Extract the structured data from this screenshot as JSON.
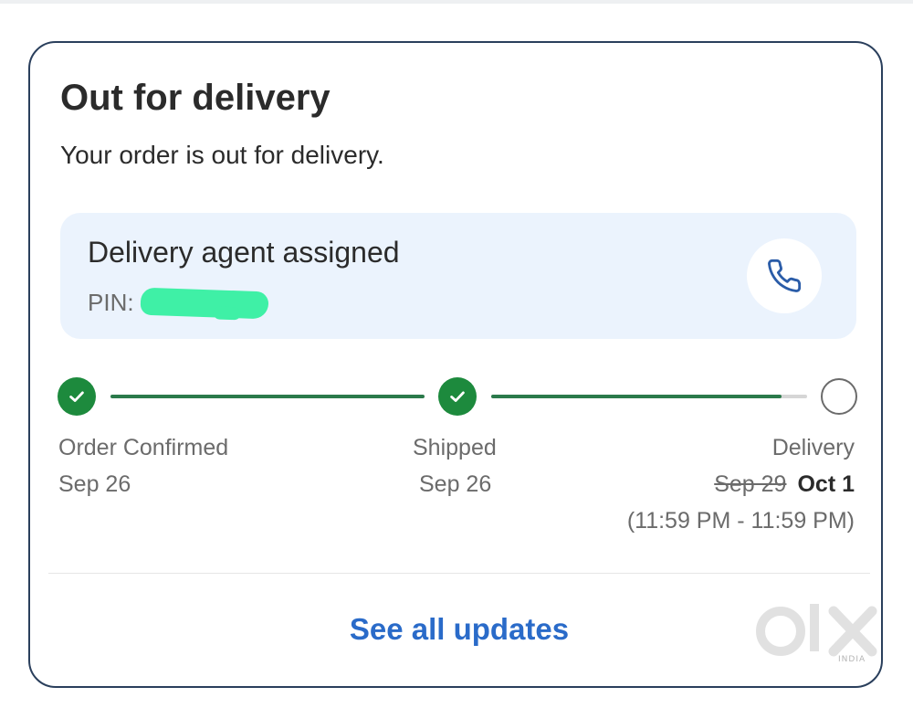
{
  "card": {
    "title": "Out for delivery",
    "subtitle": "Your order is out for delivery."
  },
  "agent": {
    "title": "Delivery agent assigned",
    "pin_label": "PIN:",
    "call_icon": "phone-icon"
  },
  "tracker": {
    "progress_fraction": 0.92,
    "steps": [
      {
        "label": "Order Confirmed",
        "date": "Sep 26",
        "status": "done"
      },
      {
        "label": "Shipped",
        "date": "Sep 26",
        "status": "done"
      },
      {
        "label": "Delivery",
        "old_date": "Sep 29",
        "new_date": "Oct 1",
        "time_window": "(11:59 PM - 11:59 PM)",
        "status": "pending"
      }
    ]
  },
  "footer": {
    "see_all_label": "See all updates"
  },
  "watermark": {
    "logo_text": "olx",
    "sub_text": "INDIA"
  },
  "colors": {
    "accent": "#2a6bc9",
    "success": "#1d8a3d",
    "agent_bg": "#ebf3fd",
    "redaction": "#3ff0a6",
    "border": "#2a3f5c"
  }
}
